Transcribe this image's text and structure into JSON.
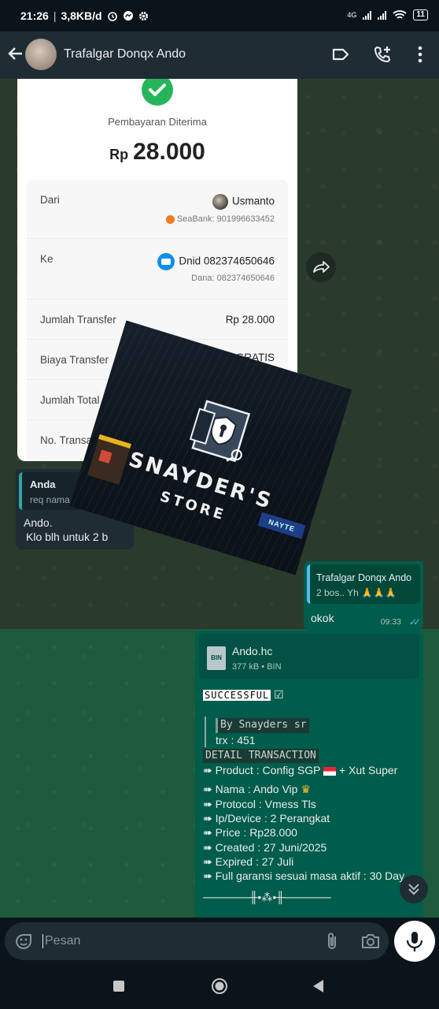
{
  "status_bar": {
    "time": "21:26",
    "speed": "3,8KB/d",
    "network": "4G",
    "battery": "11"
  },
  "header": {
    "contact_name": "Trafalgar Donqx Ando",
    "icons": [
      "back-arrow-icon",
      "label-icon",
      "add-call-icon",
      "more-vert-icon"
    ]
  },
  "receipt": {
    "status": "Pembayaran Diterima",
    "currency": "Rp",
    "amount": "28.000",
    "from_label": "Dari",
    "from_name": "Usmanto",
    "from_account": "SeaBank: 901996633452",
    "to_label": "Ke",
    "to_name": "Dnid 082374650646",
    "to_account": "Dana: 082374650646",
    "transfer_amount_label": "Jumlah Transfer",
    "transfer_amount_value": "Rp 28.000",
    "fee_label": "Biaya Transfer",
    "fee_value": "GRATIS",
    "total_label": "Jumlah Total",
    "txn_label": "No. Transaksi"
  },
  "reply_in": {
    "quote_name": "Anda",
    "quote_text": "req nama config",
    "line1": "Ando.",
    "line2": "Klo blh untuk 2 b"
  },
  "reply_out": {
    "quote_name": "Trafalgar Donqx Ando",
    "quote_text": "2 bos..  Yh 🙏🙏🙏",
    "message": "okok",
    "time": "09:33"
  },
  "store_image": {
    "title1": "SNAYDER'S",
    "title2": "STORE",
    "sign": "NAYTE"
  },
  "file_message": {
    "file_name": "Ando.hc",
    "file_size": "377 kB",
    "file_type": "BIN",
    "icon_label": "BIN",
    "success": "SUCCESSFUL",
    "by": "By Snayders sr",
    "trx": "trx : 451",
    "detail_header": "DETAIL TRANSACTION",
    "product": "Product : Config SGP",
    "product_suffix": "+ Xut Super",
    "name": "Nama  : Ando Vip",
    "protocol": "Protocol : Vmess Tls",
    "device": "Ip/Device : 2 Perangkat",
    "price": "Price : Rp28.000",
    "created": "Created  : 27 Juni/2025",
    "expired": "Expired : 27 Juli",
    "garansi": "Full garansi sesuai masa aktif : 30 Day",
    "divider": "──────╫•⁂•╫──────"
  },
  "input": {
    "placeholder": "Pesan"
  },
  "colors": {
    "accent_green": "#26b55b",
    "outgoing_bubble": "#005c4b",
    "incoming_bubble": "#1f2c34",
    "read_ticks": "#53bdeb"
  }
}
